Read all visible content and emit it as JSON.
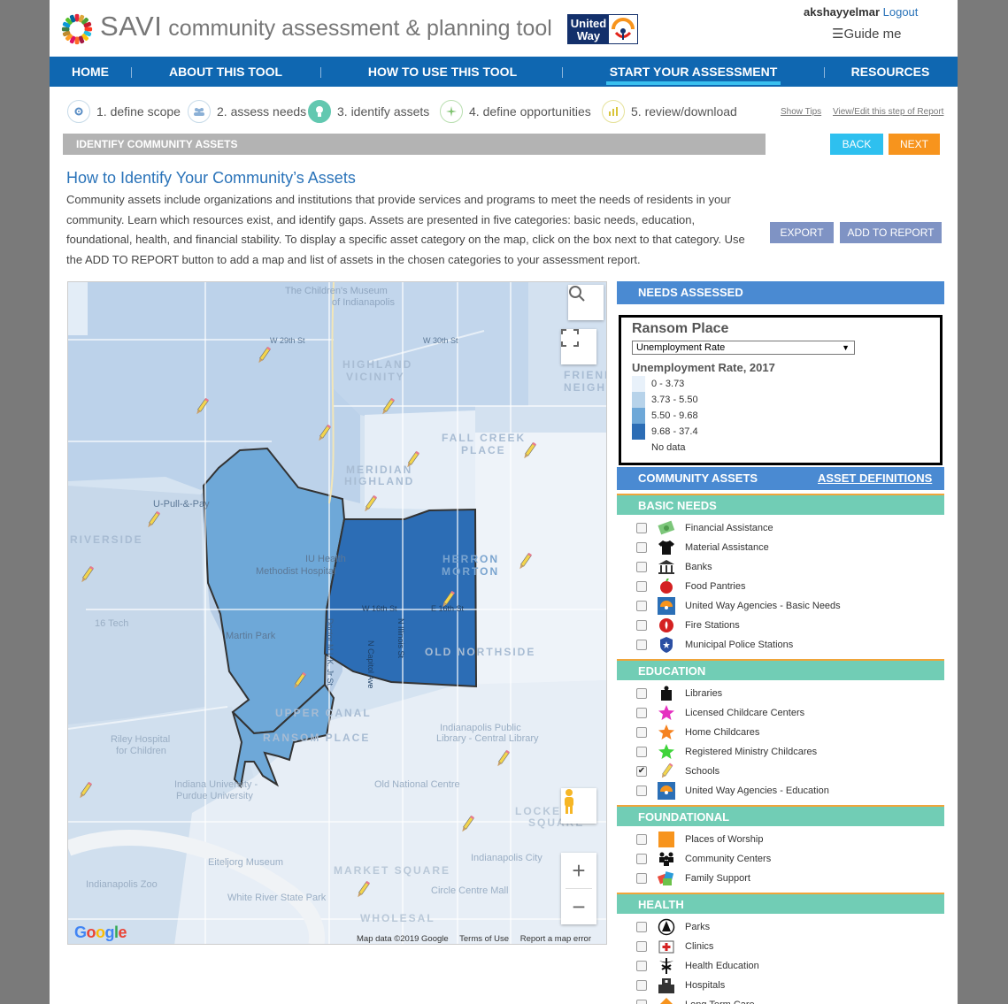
{
  "header": {
    "title_main": "SAVI",
    "title_rest": " community assessment & planning tool",
    "partner_logo": "United Way",
    "username": "akshayyelmar",
    "logout_label": "Logout",
    "guide_label": "☰Guide me"
  },
  "nav": {
    "items": [
      "HOME",
      "ABOUT THIS TOOL",
      "HOW TO USE THIS TOOL",
      "START YOUR ASSESSMENT",
      "RESOURCES"
    ],
    "active": "START YOUR ASSESSMENT"
  },
  "steps": {
    "items": [
      {
        "label": "1. define scope",
        "icon": "gear-icon"
      },
      {
        "label": "2. assess needs",
        "icon": "people-icon"
      },
      {
        "label": "3. identify assets",
        "icon": "lightbulb-icon"
      },
      {
        "label": "4. define opportunities",
        "icon": "star-icon"
      },
      {
        "label": "5. review/download",
        "icon": "report-icon"
      }
    ],
    "show_tips": "Show Tips",
    "view_edit": "View/Edit this step of Report"
  },
  "section": {
    "title": "IDENTIFY COMMUNITY ASSETS",
    "back_label": "BACK",
    "next_label": "NEXT"
  },
  "intro": {
    "heading": "How to Identify Your Community’s Assets",
    "body": "Community assets include organizations and institutions that provide services and programs to meet the needs of residents in your community. Learn which resources exist, and identify gaps. Assets are presented in five categories: basic needs, education, foundational, health, and financial stability. To display a specific asset category on the map, click on the box next to that category. Use the ADD TO REPORT button to add a map and list of assets in the chosen categories to your assessment report.",
    "export_label": "EXPORT",
    "add_report_label": "ADD TO REPORT"
  },
  "map": {
    "google_label": "Google",
    "attribution": [
      "Map data ©2019 Google",
      "Terms of Use",
      "Report a map error"
    ],
    "labels": {
      "l1": "The Children's Museum",
      "l2": "of Indianapolis",
      "l3": "HIGHLAND",
      "l4": "VICINITY",
      "l5": "MERIDIAN",
      "l6": "HIGHLAND",
      "l7": "HERRON",
      "l8": "MORTON",
      "l9": "OLD NORTHSIDE",
      "l10": "IU Health",
      "l11": "Methodist Hospital",
      "l12": "Martin Park",
      "l13": "UPPER CANAL",
      "l14": "RANSOM PLACE",
      "l15": "RIVERSIDE",
      "l16": "FALL CREEK",
      "l17": "PLACE",
      "l18": "Riley Hospital",
      "l19": "for Children",
      "l20": "Indiana University -",
      "l21": "Purdue University",
      "l22": "Eiteljorg Museum",
      "l23": "Indianapolis Zoo",
      "l24": "White River State Park",
      "l25": "WHOLESAL",
      "l26": "Old National Centre",
      "l27": "LOCKERBIE",
      "l28": "SQUARE",
      "l29": "Indianapolis City",
      "l30": "Circle Centre Mall",
      "l31": "W 16th St",
      "l32": "E 16th St",
      "l33": "W 29th St",
      "l34": "W 30th St",
      "l35": "U-Pull-&-Pay",
      "l36": "Indianapolis Public",
      "l37": "Library - Central Library",
      "l38": "FRIENDS",
      "l39": "NEIGHB",
      "l40": "16 Tech",
      "l41": "N Capitol Ave",
      "l42": "N Illinois St",
      "l43": "Doctor M.L.K. Jr St",
      "l44": "MARKET SQUARE"
    }
  },
  "panel": {
    "needs_title": "NEEDS ASSESSED",
    "place": "Ransom Place",
    "indicator": "Unemployment Rate",
    "legend_title": "Unemployment Rate, 2017",
    "legend": [
      {
        "label": " 0 - 3.73",
        "color": "#e8f1fa"
      },
      {
        "label": "3.73 - 5.50",
        "color": "#b7d3ea"
      },
      {
        "label": "5.50 - 9.68",
        "color": "#6ea8d8"
      },
      {
        "label": "9.68 - 37.4",
        "color": "#2c6db5"
      },
      {
        "label": "No data",
        "color": "#ffffff"
      }
    ],
    "assets_title": "COMMUNITY ASSETS",
    "asset_definitions": "ASSET DEFINITIONS",
    "categories": [
      {
        "name": "BASIC NEEDS",
        "items": [
          {
            "label": "Financial Assistance",
            "icon": "money-icon",
            "checked": false
          },
          {
            "label": "Material Assistance",
            "icon": "tshirt-icon",
            "checked": false
          },
          {
            "label": "Banks",
            "icon": "bank-icon",
            "checked": false
          },
          {
            "label": "Food Pantries",
            "icon": "apple-icon",
            "checked": false
          },
          {
            "label": "United Way Agencies - Basic Needs",
            "icon": "united-way-icon",
            "checked": false
          },
          {
            "label": "Fire Stations",
            "icon": "fire-station-icon",
            "checked": false
          },
          {
            "label": "Municipal Police Stations",
            "icon": "police-badge-icon",
            "checked": false
          }
        ]
      },
      {
        "name": "EDUCATION",
        "items": [
          {
            "label": "Libraries",
            "icon": "book-icon",
            "checked": false
          },
          {
            "label": "Licensed Childcare Centers",
            "icon": "pink-star-icon",
            "checked": false
          },
          {
            "label": "Home Childcares",
            "icon": "orange-star-icon",
            "checked": false
          },
          {
            "label": "Registered Ministry Childcares",
            "icon": "green-star-icon",
            "checked": false
          },
          {
            "label": "Schools",
            "icon": "pencil-icon",
            "checked": true
          },
          {
            "label": "United Way Agencies - Education",
            "icon": "united-way-icon",
            "checked": false
          }
        ]
      },
      {
        "name": "FOUNDATIONAL",
        "items": [
          {
            "label": "Places of Worship",
            "icon": "worship-icon",
            "checked": false
          },
          {
            "label": "Community Centers",
            "icon": "community-icon",
            "checked": false
          },
          {
            "label": "Family Support",
            "icon": "family-support-icon",
            "checked": false
          }
        ]
      },
      {
        "name": "HEALTH",
        "items": [
          {
            "label": "Parks",
            "icon": "park-icon",
            "checked": false
          },
          {
            "label": "Clinics",
            "icon": "clinic-icon",
            "checked": false
          },
          {
            "label": "Health Education",
            "icon": "caduceus-icon",
            "checked": false
          },
          {
            "label": "Hospitals",
            "icon": "hospital-icon",
            "checked": false
          },
          {
            "label": "Long Term Care",
            "icon": "long-term-care-icon",
            "checked": false
          }
        ]
      }
    ]
  }
}
